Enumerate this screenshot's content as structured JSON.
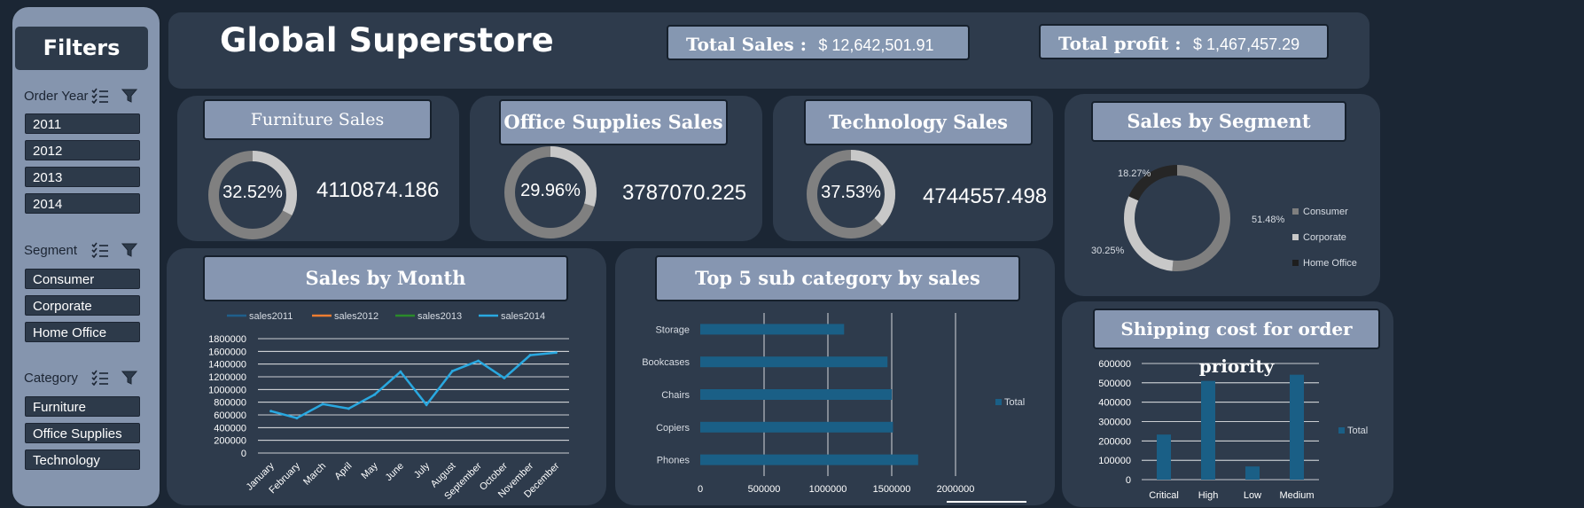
{
  "filters": {
    "title": "Filters",
    "groups": [
      {
        "label": "Order Year",
        "items": [
          "2011",
          "2012",
          "2013",
          "2014"
        ]
      },
      {
        "label": "Segment",
        "items": [
          "Consumer",
          "Corporate",
          "Home Office"
        ]
      },
      {
        "label": "Category",
        "items": [
          "Furniture",
          "Office Supplies",
          "Technology"
        ]
      }
    ]
  },
  "header": {
    "title": "Global Superstore",
    "total_sales_label": "Total Sales :",
    "total_sales_value": "$  12,642,501.91",
    "total_profit_label": "Total profit :",
    "total_profit_value": "$  1,467,457.29"
  },
  "kpis": [
    {
      "title": "Furniture Sales",
      "percent_label": "32.52%",
      "percent": 32.52,
      "value": "4110874.186"
    },
    {
      "title": "Office Supplies Sales",
      "percent_label": "29.96%",
      "percent": 29.96,
      "value": "3787070.225"
    },
    {
      "title": "Technology Sales",
      "percent_label": "37.53%",
      "percent": 37.53,
      "value": "4744557.498"
    }
  ],
  "colors": {
    "background": "#1b2634",
    "panel": "#2e3b4c",
    "title_box": "#8696b1",
    "donut_ring": "#808080",
    "donut_fill": "#c8c8c8",
    "bar": "#1a5f86",
    "sales2011": "#1f5f8b",
    "sales2012": "#ed7d31",
    "sales2013": "#2a8a2a",
    "sales2014": "#29a8e0"
  },
  "chart_data": [
    {
      "type": "pie",
      "title": "Sales by Segment",
      "categories": [
        "Consumer",
        "Corporate",
        "Home Office"
      ],
      "values": [
        51.48,
        30.25,
        18.27
      ],
      "value_labels": [
        "51.48%",
        "30.25%",
        "18.27%"
      ],
      "colors": [
        "#7f7f7f",
        "#c8c8c8",
        "#262626"
      ],
      "legend": "right"
    },
    {
      "type": "line",
      "title": "Sales by Month",
      "categories": [
        "January",
        "February",
        "March",
        "April",
        "May",
        "June",
        "July",
        "August",
        "September",
        "October",
        "November",
        "December"
      ],
      "series": [
        {
          "name": "sales2011",
          "values": []
        },
        {
          "name": "sales2012",
          "values": []
        },
        {
          "name": "sales2013",
          "values": []
        },
        {
          "name": "sales2014",
          "values": [
            660000,
            550000,
            770000,
            700000,
            920000,
            1280000,
            760000,
            1290000,
            1450000,
            1180000,
            1540000,
            1580000
          ]
        }
      ],
      "yticks": [
        "1800000",
        "1600000",
        "1400000",
        "1200000",
        "1000000",
        "800000",
        "600000",
        "400000",
        "200000",
        "0"
      ],
      "ylim": [
        0,
        1800000
      ],
      "grid": true,
      "legend": "top"
    },
    {
      "type": "bar",
      "orientation": "horizontal",
      "title": "Top 5 sub category by sales",
      "categories": [
        "Storage",
        "Bookcases",
        "Chairs",
        "Copiers",
        "Phones"
      ],
      "series": [
        {
          "name": "Total",
          "values": [
            1127000,
            1467000,
            1501000,
            1510000,
            1707000
          ]
        }
      ],
      "xticks": [
        "0",
        "500000",
        "1000000",
        "1500000",
        "2000000"
      ],
      "xlim": [
        0,
        2000000
      ],
      "grid": true,
      "legend": "right"
    },
    {
      "type": "bar",
      "title": "Shipping cost for order priority",
      "categories": [
        "Critical",
        "High",
        "Low",
        "Medium"
      ],
      "series": [
        {
          "name": "Total",
          "values": [
            233000,
            510000,
            68000,
            542000
          ]
        }
      ],
      "yticks": [
        "600000",
        "500000",
        "400000",
        "300000",
        "200000",
        "100000",
        "0"
      ],
      "ylim": [
        0,
        600000
      ],
      "grid": true,
      "legend": "right"
    }
  ]
}
